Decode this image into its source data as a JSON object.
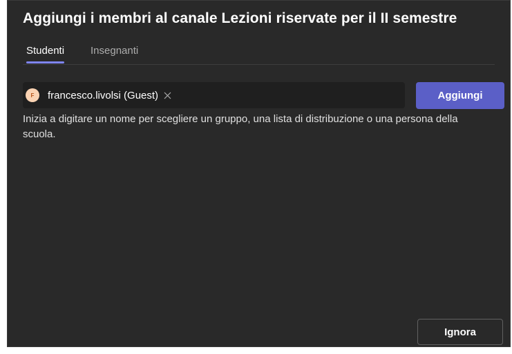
{
  "dialog": {
    "title": "Aggiungi i membri al canale Lezioni riservate per il II semestre"
  },
  "tabs": [
    {
      "label": "Studenti",
      "active": true
    },
    {
      "label": "Insegnanti",
      "active": false
    }
  ],
  "people_picker": {
    "chips": [
      {
        "initial": "F",
        "label": "francesco.livolsi (Guest)",
        "remove_icon": "close-icon"
      }
    ],
    "hint": "Inizia a digitare un nome per scegliere un gruppo, una lista di distribuzione o una persona della scuola."
  },
  "buttons": {
    "add_label": "Aggiungi",
    "ignore_label": "Ignora"
  },
  "colors": {
    "background": "#292929",
    "accent": "#5b5fc7",
    "tab_indicator": "#7f85f5",
    "avatar_bg": "#fbd3b3"
  }
}
